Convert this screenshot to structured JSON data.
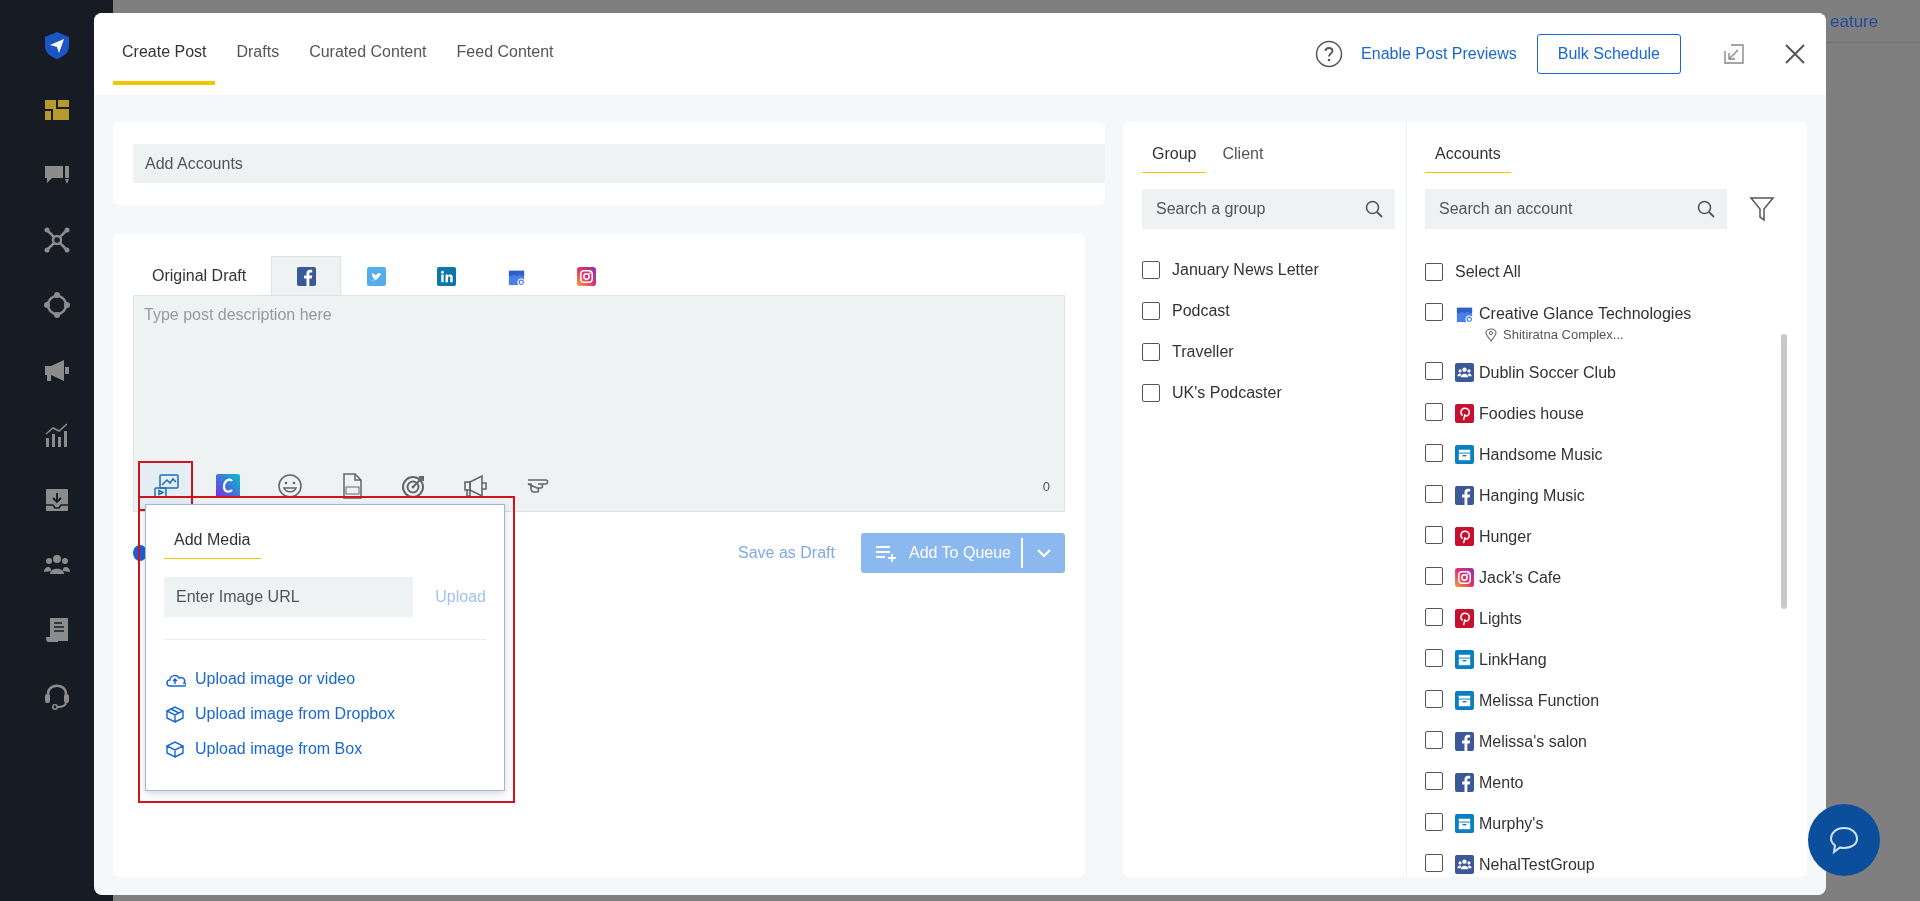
{
  "background_text": "eature",
  "sidebar_icons": [
    {
      "kind": "logo",
      "selected": false
    },
    {
      "kind": "dashboard",
      "selected": true
    },
    {
      "kind": "comments",
      "selected": false
    },
    {
      "kind": "network",
      "selected": false
    },
    {
      "kind": "target",
      "selected": false
    },
    {
      "kind": "megaphone",
      "selected": false
    },
    {
      "kind": "chart",
      "selected": false
    },
    {
      "kind": "inbox",
      "selected": false
    },
    {
      "kind": "team",
      "selected": false
    },
    {
      "kind": "document",
      "selected": false
    },
    {
      "kind": "support",
      "selected": false
    }
  ],
  "tabs": [
    {
      "label": "Create Post",
      "selected": true
    },
    {
      "label": "Drafts",
      "selected": false
    },
    {
      "label": "Curated Content",
      "selected": false
    },
    {
      "label": "Feed Content",
      "selected": false
    }
  ],
  "header": {
    "link": "Enable Post Previews",
    "button": "Bulk Schedule"
  },
  "accounts_field": {
    "placeholder": "Add Accounts"
  },
  "editor": {
    "network_tabs": [
      {
        "kind": "draft",
        "label": "Original Draft",
        "selected": false
      },
      {
        "kind": "facebook",
        "selected": true
      },
      {
        "kind": "twitter",
        "selected": false
      },
      {
        "kind": "linkedin",
        "selected": false
      },
      {
        "kind": "gmb",
        "selected": false
      },
      {
        "kind": "instagram",
        "selected": false
      }
    ],
    "placeholder": "Type post description here",
    "tools": [
      {
        "kind": "media",
        "highlighted": true
      },
      {
        "kind": "canva",
        "highlighted": false
      },
      {
        "kind": "emoji",
        "highlighted": false
      },
      {
        "kind": "gif",
        "highlighted": false
      },
      {
        "kind": "target",
        "highlighted": false
      },
      {
        "kind": "megaphone",
        "highlighted": false
      },
      {
        "kind": "hand",
        "highlighted": false
      }
    ],
    "char_count": "0",
    "save_draft": "Save as Draft",
    "queue_button": "Add To Queue"
  },
  "media_popup": {
    "highlighted": true,
    "tab": {
      "label": "Add Media",
      "selected": true
    },
    "url_placeholder": "Enter Image URL",
    "upload": "Upload",
    "options": [
      {
        "kind": "cloud",
        "label": "Upload image or video"
      },
      {
        "kind": "dropbox",
        "label": "Upload image from Dropbox"
      },
      {
        "kind": "box",
        "label": "Upload image from Box"
      }
    ]
  },
  "groups_panel": {
    "tabs": [
      {
        "label": "Group",
        "selected": true
      },
      {
        "label": "Client",
        "selected": false
      }
    ],
    "search_placeholder": "Search a group",
    "items": [
      {
        "label": "January News Letter",
        "checked": false
      },
      {
        "label": "Podcast",
        "checked": false
      },
      {
        "label": "Traveller",
        "checked": false
      },
      {
        "label": "UK's Podcaster",
        "checked": false
      }
    ]
  },
  "accounts_panel": {
    "tab": {
      "label": "Accounts",
      "selected": true
    },
    "search_placeholder": "Search an account",
    "select_all": {
      "label": "Select All",
      "checked": false
    },
    "accounts": [
      {
        "name": "Creative Glance Technologies",
        "kind": "gmb",
        "location": "Shitiratna Complex...",
        "checked": false
      },
      {
        "name": "Dublin Soccer Club",
        "kind": "group",
        "checked": false
      },
      {
        "name": "Foodies house",
        "kind": "pinterest",
        "checked": false
      },
      {
        "name": "Handsome Music",
        "kind": "business",
        "checked": false
      },
      {
        "name": "Hanging Music",
        "kind": "facebook",
        "checked": false
      },
      {
        "name": "Hunger",
        "kind": "pinterest",
        "checked": false
      },
      {
        "name": "Jack's Cafe",
        "kind": "instagram",
        "checked": false
      },
      {
        "name": "Lights",
        "kind": "pinterest",
        "checked": false
      },
      {
        "name": "LinkHang",
        "kind": "business",
        "checked": false
      },
      {
        "name": "Melissa Function",
        "kind": "business",
        "checked": false
      },
      {
        "name": "Melissa's salon",
        "kind": "facebook",
        "checked": false
      },
      {
        "name": "Mento",
        "kind": "facebook",
        "checked": false
      },
      {
        "name": "Murphy's",
        "kind": "business",
        "checked": false
      },
      {
        "name": "NehalTestGroup",
        "kind": "group",
        "checked": false
      }
    ]
  }
}
